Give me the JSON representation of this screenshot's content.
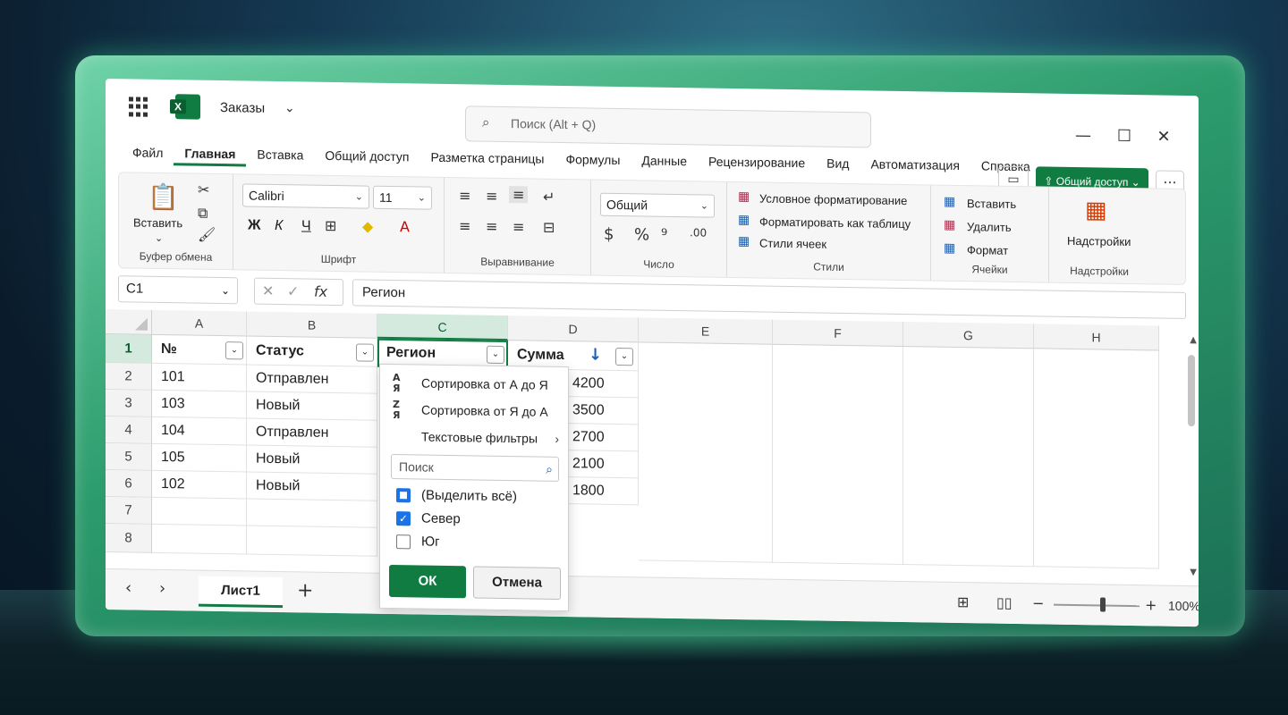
{
  "app": {
    "title": "Заказы"
  },
  "search": {
    "placeholder": "Поиск (Alt + Q)"
  },
  "tabs": [
    "Файл",
    "Главная",
    "Вставка",
    "Общий доступ",
    "Разметка страницы",
    "Формулы",
    "Данные",
    "Рецензирование",
    "Вид",
    "Автоматизация",
    "Справка"
  ],
  "active_tab": "Главная",
  "share_label": "Общий доступ",
  "ribbon": {
    "clipboard": {
      "paste": "Вставить",
      "label": "Буфер обмена"
    },
    "font": {
      "name": "Calibri",
      "size": "11",
      "bold": "Ж",
      "italic": "К",
      "underline": "Ч",
      "label": "Шрифт"
    },
    "alignment": {
      "label": "Выравнивание"
    },
    "number": {
      "format": "Общий",
      "label": "Число"
    },
    "styles": {
      "conditional": "Условное форматирование",
      "as_table": "Форматировать как таблицу",
      "cell_styles": "Стили ячеек",
      "label": "Стили"
    },
    "cells": {
      "insert": "Вставить",
      "delete": "Удалить",
      "format": "Формат",
      "label": "Ячейки"
    },
    "addins": {
      "button": "Надстройки",
      "label": "Надстройки"
    }
  },
  "formula_bar": {
    "name_box": "C1",
    "fx": "fx",
    "value": "Регион"
  },
  "columns": [
    "A",
    "B",
    "C",
    "D",
    "E",
    "F",
    "G",
    "H"
  ],
  "rows": [
    "1",
    "2",
    "3",
    "4",
    "5",
    "6",
    "7",
    "8"
  ],
  "table": {
    "headers": [
      "№",
      "Статус",
      "Регион",
      "Сумма"
    ],
    "data": [
      [
        "101",
        "Отправлен",
        "",
        "4200"
      ],
      [
        "103",
        "Новый",
        "",
        "3500"
      ],
      [
        "104",
        "Отправлен",
        "",
        "2700"
      ],
      [
        "105",
        "Новый",
        "",
        "2100"
      ],
      [
        "102",
        "Новый",
        "",
        "1800"
      ]
    ]
  },
  "filter_panel": {
    "sort_asc": "Сортировка от А до Я",
    "sort_desc": "Сортировка от Я до А",
    "text_filters": "Текстовые фильтры",
    "search_placeholder": "Поиск",
    "items": [
      {
        "label": "(Выделить всё)",
        "state": "partial"
      },
      {
        "label": "Север",
        "state": "checked"
      },
      {
        "label": "Юг",
        "state": "unchecked"
      }
    ],
    "ok": "ОК",
    "cancel": "Отмена"
  },
  "status_bar": {
    "sheet": "Лист1",
    "zoom": "100%"
  },
  "colors": {
    "accent": "#107c41",
    "check": "#1a73e8"
  }
}
